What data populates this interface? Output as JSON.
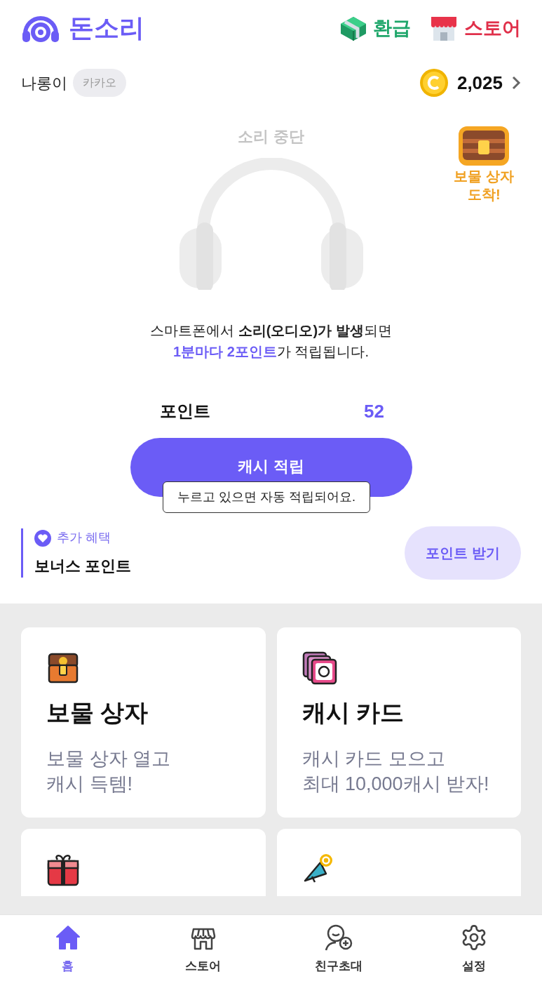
{
  "header": {
    "app_name": "돈소리",
    "actions": [
      {
        "kind": "refund",
        "label": "환급"
      },
      {
        "kind": "store",
        "label": "스토어"
      }
    ]
  },
  "user": {
    "name": "나롱이",
    "login": "카카오",
    "coins": "2,025"
  },
  "player": {
    "status": "소리 중단",
    "playing": false,
    "description": [
      "스마트폰에서 **소리(오디오)가 발생**되면",
      "**1분마다 2포인트**가 적립됩니다."
    ]
  },
  "treasure_notice": {
    "line1": "보물 상자",
    "line2": "도착!"
  },
  "points": {
    "label": "포인트",
    "value": "52"
  },
  "cash_button": {
    "label": "캐시 적립",
    "tooltip": "누르고 있으면 자동 적립되어요."
  },
  "bonus": {
    "tag": "추가 혜택",
    "title": "보너스 포인트",
    "button": "포인트 받기"
  },
  "cards": [
    {
      "kind": "chest",
      "title": "보물 상자",
      "text": [
        "보물 상자 열고",
        "캐시 득템!"
      ]
    },
    {
      "kind": "cards",
      "title": "캐시 카드",
      "text": [
        "캐시 카드 모으고",
        "최대 10,000캐시 받자!"
      ]
    },
    {
      "kind": "gift"
    },
    {
      "kind": "megaphone"
    }
  ],
  "nav": [
    {
      "kind": "home",
      "label": "홈",
      "selected": true
    },
    {
      "kind": "store",
      "label": "스토어",
      "selected": false
    },
    {
      "kind": "invite",
      "label": "친구초대",
      "selected": false
    },
    {
      "kind": "settings",
      "label": "설정",
      "selected": false
    }
  ]
}
